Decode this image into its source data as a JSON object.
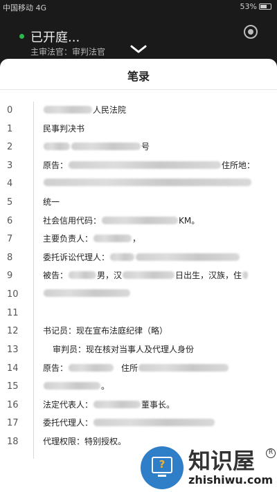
{
  "status_bar": {
    "carrier": "中国移动 4G",
    "battery": "53%"
  },
  "header": {
    "status_text": "已开庭...",
    "judge_line": "主审法官：审判法官",
    "status_dot_color": "#2db84d"
  },
  "sheet": {
    "title": "笔录",
    "line_numbers": [
      "0",
      "1",
      "2",
      "3",
      "4",
      "5",
      "6",
      "7",
      "8",
      "9",
      "10",
      "11",
      "12",
      "13",
      "14",
      "15",
      "16",
      "17",
      "18"
    ],
    "lines": [
      {
        "text_a": "人民法院"
      },
      {
        "text_a": "民事判决书"
      },
      {
        "text_a": "号"
      },
      {
        "text_a": "原告：",
        "text_b": "住所地："
      },
      {},
      {
        "text_a": "统一"
      },
      {
        "text_a": "社会信用代码：",
        "text_b": "KM。"
      },
      {
        "text_a": "主要负责人：",
        "text_b": "，"
      },
      {
        "text_a": "委托诉讼代理人："
      },
      {
        "text_a": "被告：",
        "text_b": "男，汉",
        "text_c": "日出生，汉族，住"
      },
      {},
      {},
      {
        "text_a": "书记员：现在宣布法庭纪律（略）"
      },
      {
        "text_a": "审判员：现在核对当事人及代理人身份"
      },
      {
        "text_a": "原告：",
        "text_b": "住所"
      },
      {
        "text_a": "。"
      },
      {
        "text_a": "法定代表人：",
        "text_b": "董事长。"
      },
      {
        "text_a": "委托代理人："
      },
      {
        "text_a": "代理权限：特别授权。"
      }
    ]
  },
  "watermark": {
    "cn": "知识屋",
    "en": "zhishiwu.com",
    "reg": "R",
    "icon": "question-monitor-icon",
    "color": "#2f7fc8"
  }
}
